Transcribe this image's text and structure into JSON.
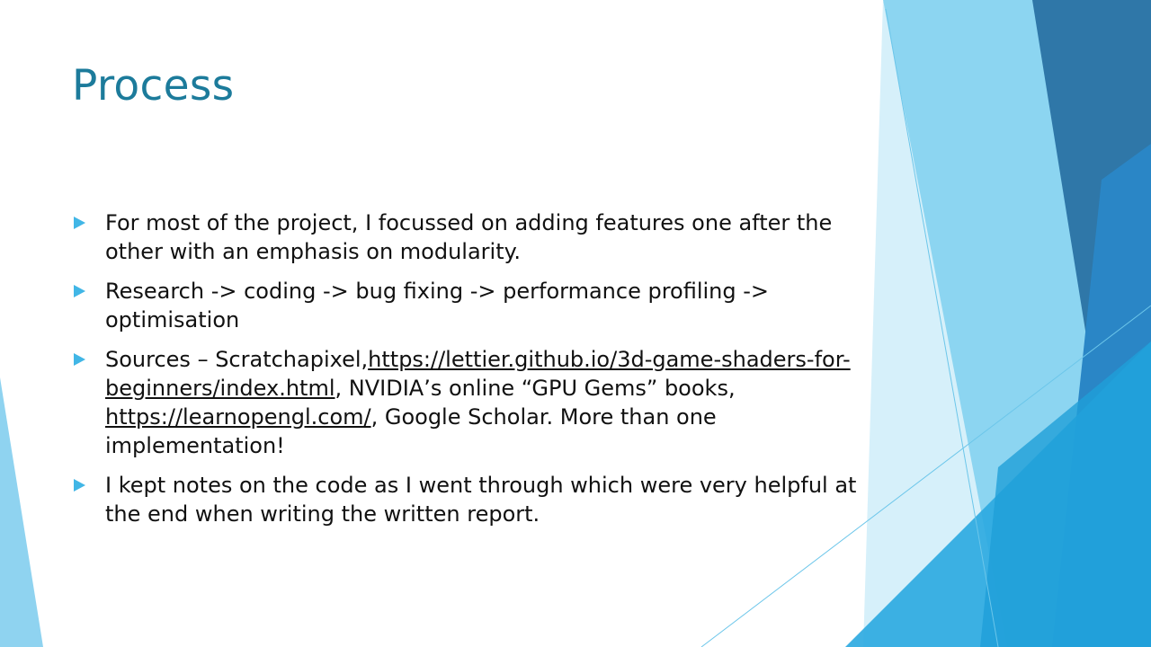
{
  "slide": {
    "title": "Process",
    "accent_color": "#1c7b9b",
    "bullet_color": "#41b6e6",
    "bullets": [
      {
        "text": "For most of the project, I focussed on adding features one after the other with an emphasis on modularity."
      },
      {
        "text": "Research -> coding -> bug fixing -> performance profiling -> optimisation"
      },
      {
        "pre": "Sources – Scratchapixel,",
        "link1": "https://lettier.github.io/3d-game-shaders-for-beginners/index.html",
        "mid": ", NVIDIA’s online “GPU Gems” books, ",
        "link2": "https://learnopengl.com/",
        "post": ", Google Scholar. More than one implementation!"
      },
      {
        "text": "I kept notes on the code as I went through which were very helpful at the end when writing the written report."
      }
    ]
  }
}
